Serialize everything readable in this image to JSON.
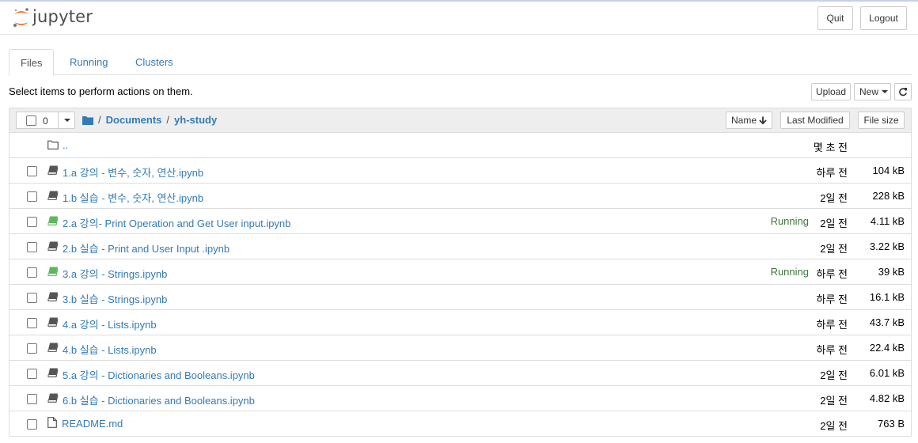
{
  "header": {
    "logo_text": "jupyter",
    "quit_label": "Quit",
    "logout_label": "Logout"
  },
  "tabs": [
    {
      "label": "Files",
      "active": true
    },
    {
      "label": "Running",
      "active": false
    },
    {
      "label": "Clusters",
      "active": false
    }
  ],
  "toolbar": {
    "hint": "Select items to perform actions on them.",
    "upload_label": "Upload",
    "new_label": "New",
    "refresh_icon": "refresh-icon"
  },
  "list_header": {
    "selected_count": "0",
    "breadcrumb": [
      "Documents",
      "yh-study"
    ],
    "sort_name_label": "Name",
    "sort_modified_label": "Last Modified",
    "sort_size_label": "File size"
  },
  "parent_row": {
    "name": "..",
    "modified": "몇 초 전"
  },
  "files": [
    {
      "name": "1.a 강의 - 변수, 숫자, 연산.ipynb",
      "type": "notebook",
      "running": "",
      "modified": "하루 전",
      "size": "104 kB"
    },
    {
      "name": "1.b 실습 - 변수, 숫자, 연산.ipynb",
      "type": "notebook",
      "running": "",
      "modified": "2일 전",
      "size": "228 kB"
    },
    {
      "name": "2.a 강의- Print Operation and Get User input.ipynb",
      "type": "notebook-running",
      "running": "Running",
      "modified": "2일 전",
      "size": "4.11 kB"
    },
    {
      "name": "2.b 실습 - Print and User Input .ipynb",
      "type": "notebook",
      "running": "",
      "modified": "2일 전",
      "size": "3.22 kB"
    },
    {
      "name": "3.a 강의 - Strings.ipynb",
      "type": "notebook-running",
      "running": "Running",
      "modified": "하루 전",
      "size": "39 kB"
    },
    {
      "name": "3.b 실습 - Strings.ipynb",
      "type": "notebook",
      "running": "",
      "modified": "하루 전",
      "size": "16.1 kB"
    },
    {
      "name": "4.a 강의 - Lists.ipynb",
      "type": "notebook",
      "running": "",
      "modified": "하루 전",
      "size": "43.7 kB"
    },
    {
      "name": "4.b 실습 - Lists.ipynb",
      "type": "notebook",
      "running": "",
      "modified": "하루 전",
      "size": "22.4 kB"
    },
    {
      "name": "5.a 강의 - Dictionaries and Booleans.ipynb",
      "type": "notebook",
      "running": "",
      "modified": "2일 전",
      "size": "6.01 kB"
    },
    {
      "name": "6.b 실습 - Dictionaries and Booleans.ipynb",
      "type": "notebook",
      "running": "",
      "modified": "2일 전",
      "size": "4.82 kB"
    },
    {
      "name": "README.md",
      "type": "file",
      "running": "",
      "modified": "2일 전",
      "size": "763 B"
    }
  ],
  "colors": {
    "link": "#337ab7",
    "running": "#3c763d",
    "notebook_icon": "#555555",
    "notebook_running_icon": "#5cb85c",
    "logo_orange": "#f37726"
  }
}
